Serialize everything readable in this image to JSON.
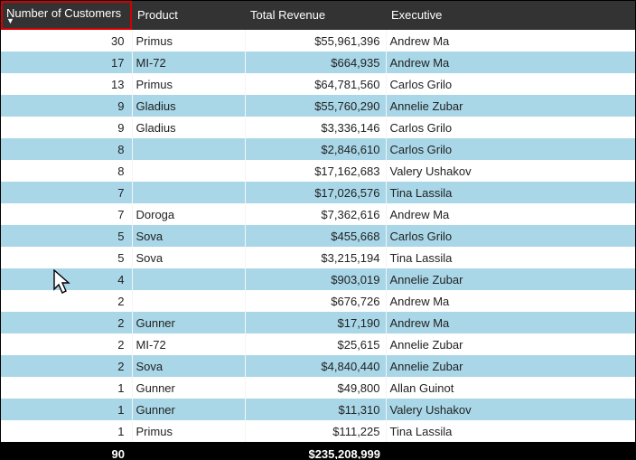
{
  "headers": {
    "customers": "Number of Customers",
    "product": "Product",
    "revenue": "Total Revenue",
    "executive": "Executive"
  },
  "sort_indicator": "▼",
  "rows": [
    {
      "customers": "30",
      "product": "Primus",
      "revenue": "$55,961,396",
      "executive": "Andrew Ma"
    },
    {
      "customers": "17",
      "product": "MI-72",
      "revenue": "$664,935",
      "executive": "Andrew Ma"
    },
    {
      "customers": "13",
      "product": "Primus",
      "revenue": "$64,781,560",
      "executive": "Carlos Grilo"
    },
    {
      "customers": "9",
      "product": "Gladius",
      "revenue": "$55,760,290",
      "executive": "Annelie Zubar"
    },
    {
      "customers": "9",
      "product": "Gladius",
      "revenue": "$3,336,146",
      "executive": "Carlos Grilo"
    },
    {
      "customers": "8",
      "product": "",
      "revenue": "$2,846,610",
      "executive": "Carlos Grilo"
    },
    {
      "customers": "8",
      "product": "",
      "revenue": "$17,162,683",
      "executive": "Valery Ushakov"
    },
    {
      "customers": "7",
      "product": "",
      "revenue": "$17,026,576",
      "executive": "Tina Lassila"
    },
    {
      "customers": "7",
      "product": "Doroga",
      "revenue": "$7,362,616",
      "executive": "Andrew Ma"
    },
    {
      "customers": "5",
      "product": "Sova",
      "revenue": "$455,668",
      "executive": "Carlos Grilo"
    },
    {
      "customers": "5",
      "product": "Sova",
      "revenue": "$3,215,194",
      "executive": "Tina Lassila"
    },
    {
      "customers": "4",
      "product": "",
      "revenue": "$903,019",
      "executive": "Annelie Zubar"
    },
    {
      "customers": "2",
      "product": "",
      "revenue": "$676,726",
      "executive": "Andrew Ma"
    },
    {
      "customers": "2",
      "product": "Gunner",
      "revenue": "$17,190",
      "executive": "Andrew Ma"
    },
    {
      "customers": "2",
      "product": "MI-72",
      "revenue": "$25,615",
      "executive": "Annelie Zubar"
    },
    {
      "customers": "2",
      "product": "Sova",
      "revenue": "$4,840,440",
      "executive": "Annelie Zubar"
    },
    {
      "customers": "1",
      "product": "Gunner",
      "revenue": "$49,800",
      "executive": "Allan Guinot"
    },
    {
      "customers": "1",
      "product": "Gunner",
      "revenue": "$11,310",
      "executive": "Valery Ushakov"
    },
    {
      "customers": "1",
      "product": "Primus",
      "revenue": "$111,225",
      "executive": "Tina Lassila"
    }
  ],
  "totals": {
    "customers": "90",
    "revenue": "$235,208,999"
  }
}
